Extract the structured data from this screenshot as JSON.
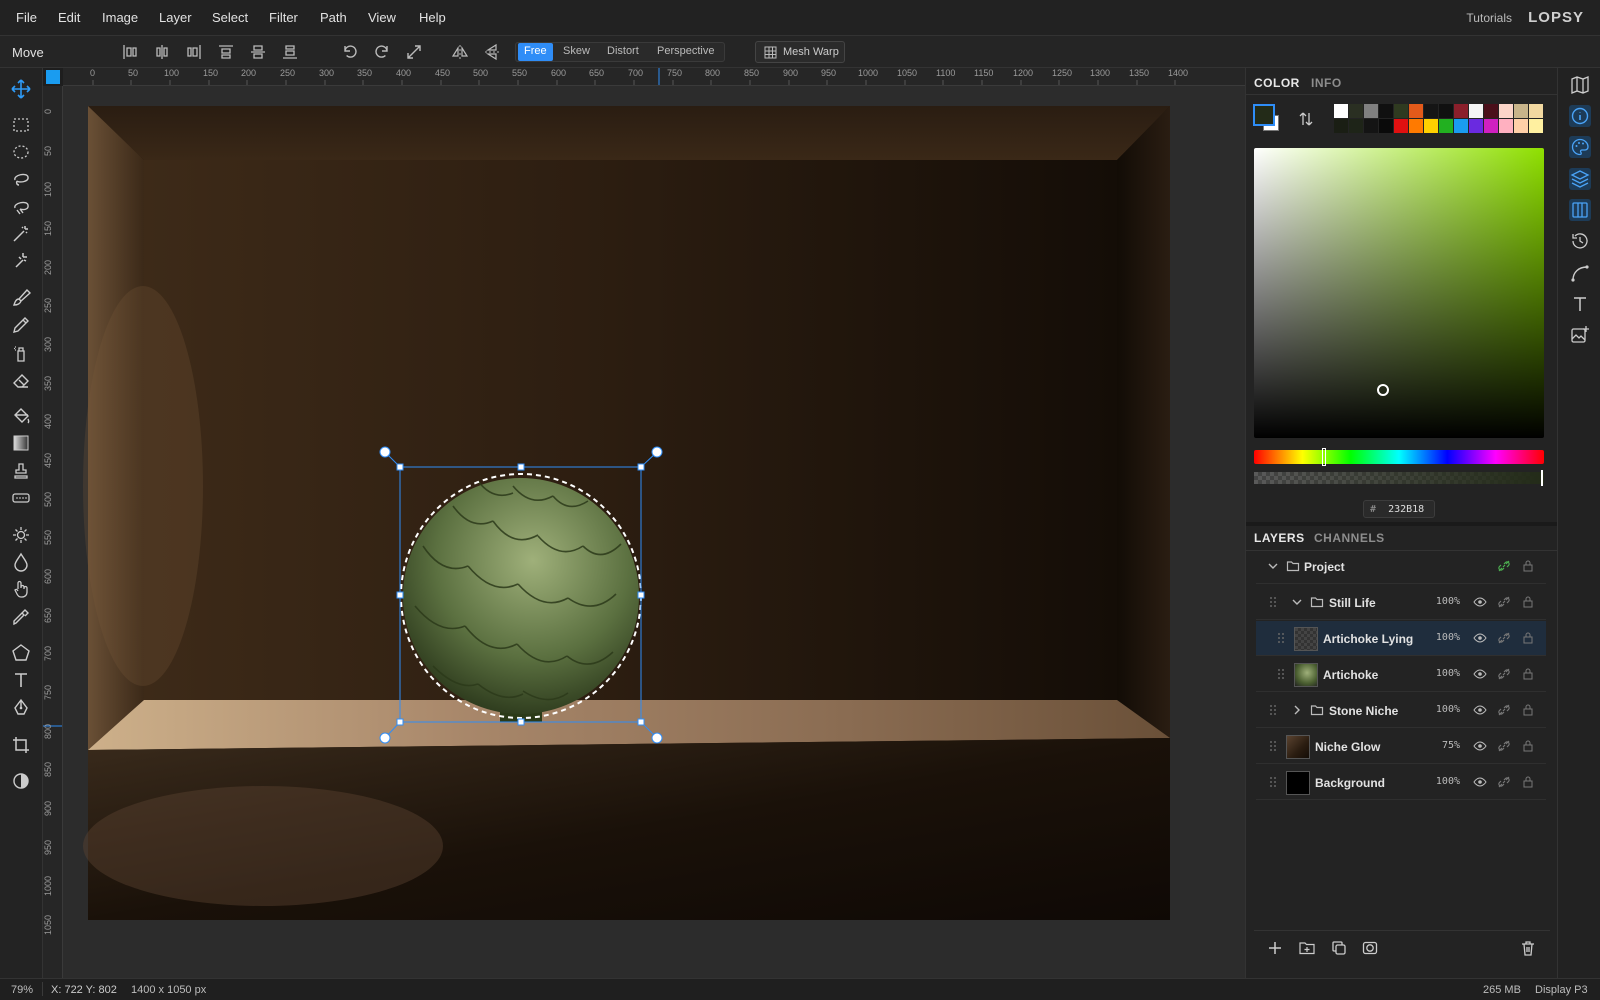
{
  "menubar": {
    "items": [
      "File",
      "Edit",
      "Image",
      "Layer",
      "Select",
      "Filter",
      "Path",
      "View",
      "Help"
    ],
    "tutorials_label": "Tutorials",
    "brand": "LOPSY"
  },
  "options_bar": {
    "tool_name": "Move",
    "transform_modes": [
      "Free",
      "Skew",
      "Distort",
      "Perspective"
    ],
    "active_mode": "Free",
    "mesh_warp_label": "Mesh Warp"
  },
  "rulers": {
    "horizontal": [
      "0",
      "50",
      "100",
      "150",
      "200",
      "250",
      "300",
      "350",
      "400",
      "450",
      "500",
      "550",
      "600",
      "650",
      "700",
      "750",
      "800",
      "850",
      "900",
      "950",
      "1000",
      "1050",
      "1100",
      "1150",
      "1200",
      "1250",
      "1300",
      "1350",
      "1400"
    ],
    "vertical": [
      "0",
      "50",
      "100",
      "150",
      "200",
      "250",
      "300",
      "350",
      "400",
      "450",
      "500",
      "550",
      "600",
      "650",
      "700",
      "750",
      "800",
      "850",
      "900",
      "950",
      "1000",
      "1050"
    ]
  },
  "color_panel": {
    "tabs": [
      "COLOR",
      "INFO"
    ],
    "active_tab": "COLOR",
    "hex_prefix": "#",
    "hex_value": "232B18",
    "foreground_color": "#232B18",
    "background_color": "#ffffff",
    "picker_hue_color": "#8fe000",
    "swatches_row1": [
      "#ffffff",
      "#2a2f22",
      "#808080",
      "#101010",
      "#2f3a20",
      "#e35a1a",
      "#151515",
      "#101010",
      "#8a1f2b",
      "#f4f4f4",
      "#4a0f1a",
      "#fbd5c8",
      "#c8b48a",
      "#f2d8a0"
    ],
    "swatches_row2": [
      "#1a1e14",
      "#1e2418",
      "#141414",
      "#0a0a0a",
      "#e01010",
      "#ff7a00",
      "#ffd000",
      "#22b020",
      "#1a9cf0",
      "#6a2ae0",
      "#d020c0",
      "#ffb0c0",
      "#ffd0a8",
      "#fff0a0"
    ]
  },
  "layers_panel": {
    "tabs": [
      "LAYERS",
      "CHANNELS"
    ],
    "active_tab": "LAYERS",
    "layers": [
      {
        "name": "Project",
        "opacity": "",
        "type": "group",
        "expanded": true,
        "depth": 0,
        "selected": false
      },
      {
        "name": "Still Life",
        "opacity": "100%",
        "type": "group",
        "expanded": true,
        "depth": 1,
        "selected": false
      },
      {
        "name": "Artichoke Lying",
        "opacity": "100%",
        "type": "layer",
        "depth": 2,
        "selected": true
      },
      {
        "name": "Artichoke",
        "opacity": "100%",
        "type": "layer",
        "depth": 2,
        "selected": false
      },
      {
        "name": "Stone Niche",
        "opacity": "100%",
        "type": "group",
        "expanded": false,
        "depth": 1,
        "selected": false
      },
      {
        "name": "Niche Glow",
        "opacity": "75%",
        "type": "layer",
        "depth": 1,
        "selected": false
      },
      {
        "name": "Background",
        "opacity": "100%",
        "type": "layer",
        "depth": 1,
        "selected": false
      }
    ]
  },
  "statusbar": {
    "zoom": "79%",
    "cursor_label": "X: 722 Y: 802",
    "dimensions": "1400 x 1050 px",
    "memory": "265 MB",
    "color_profile": "Display P3"
  },
  "icons": {
    "tools": [
      "move-icon",
      "rect-select-icon",
      "ellipse-select-icon",
      "lasso-icon",
      "magnetic-lasso-icon",
      "magic-wand-icon",
      "quick-select-icon",
      "brush-icon",
      "pencil-icon",
      "spray-icon",
      "eraser-icon",
      "paint-bucket-icon",
      "gradient-icon",
      "clone-stamp-icon",
      "healing-icon",
      "dodge-icon",
      "blur-icon",
      "smudge-hand-icon",
      "eyedropper-icon",
      "shape-icon",
      "text-icon",
      "pen-icon",
      "crop-icon",
      "contrast-icon"
    ],
    "strip": [
      "book-icon",
      "info-icon",
      "palette-icon",
      "layers-icon",
      "columns-icon",
      "history-icon",
      "path-icon",
      "text-icon",
      "image-add-icon"
    ]
  }
}
